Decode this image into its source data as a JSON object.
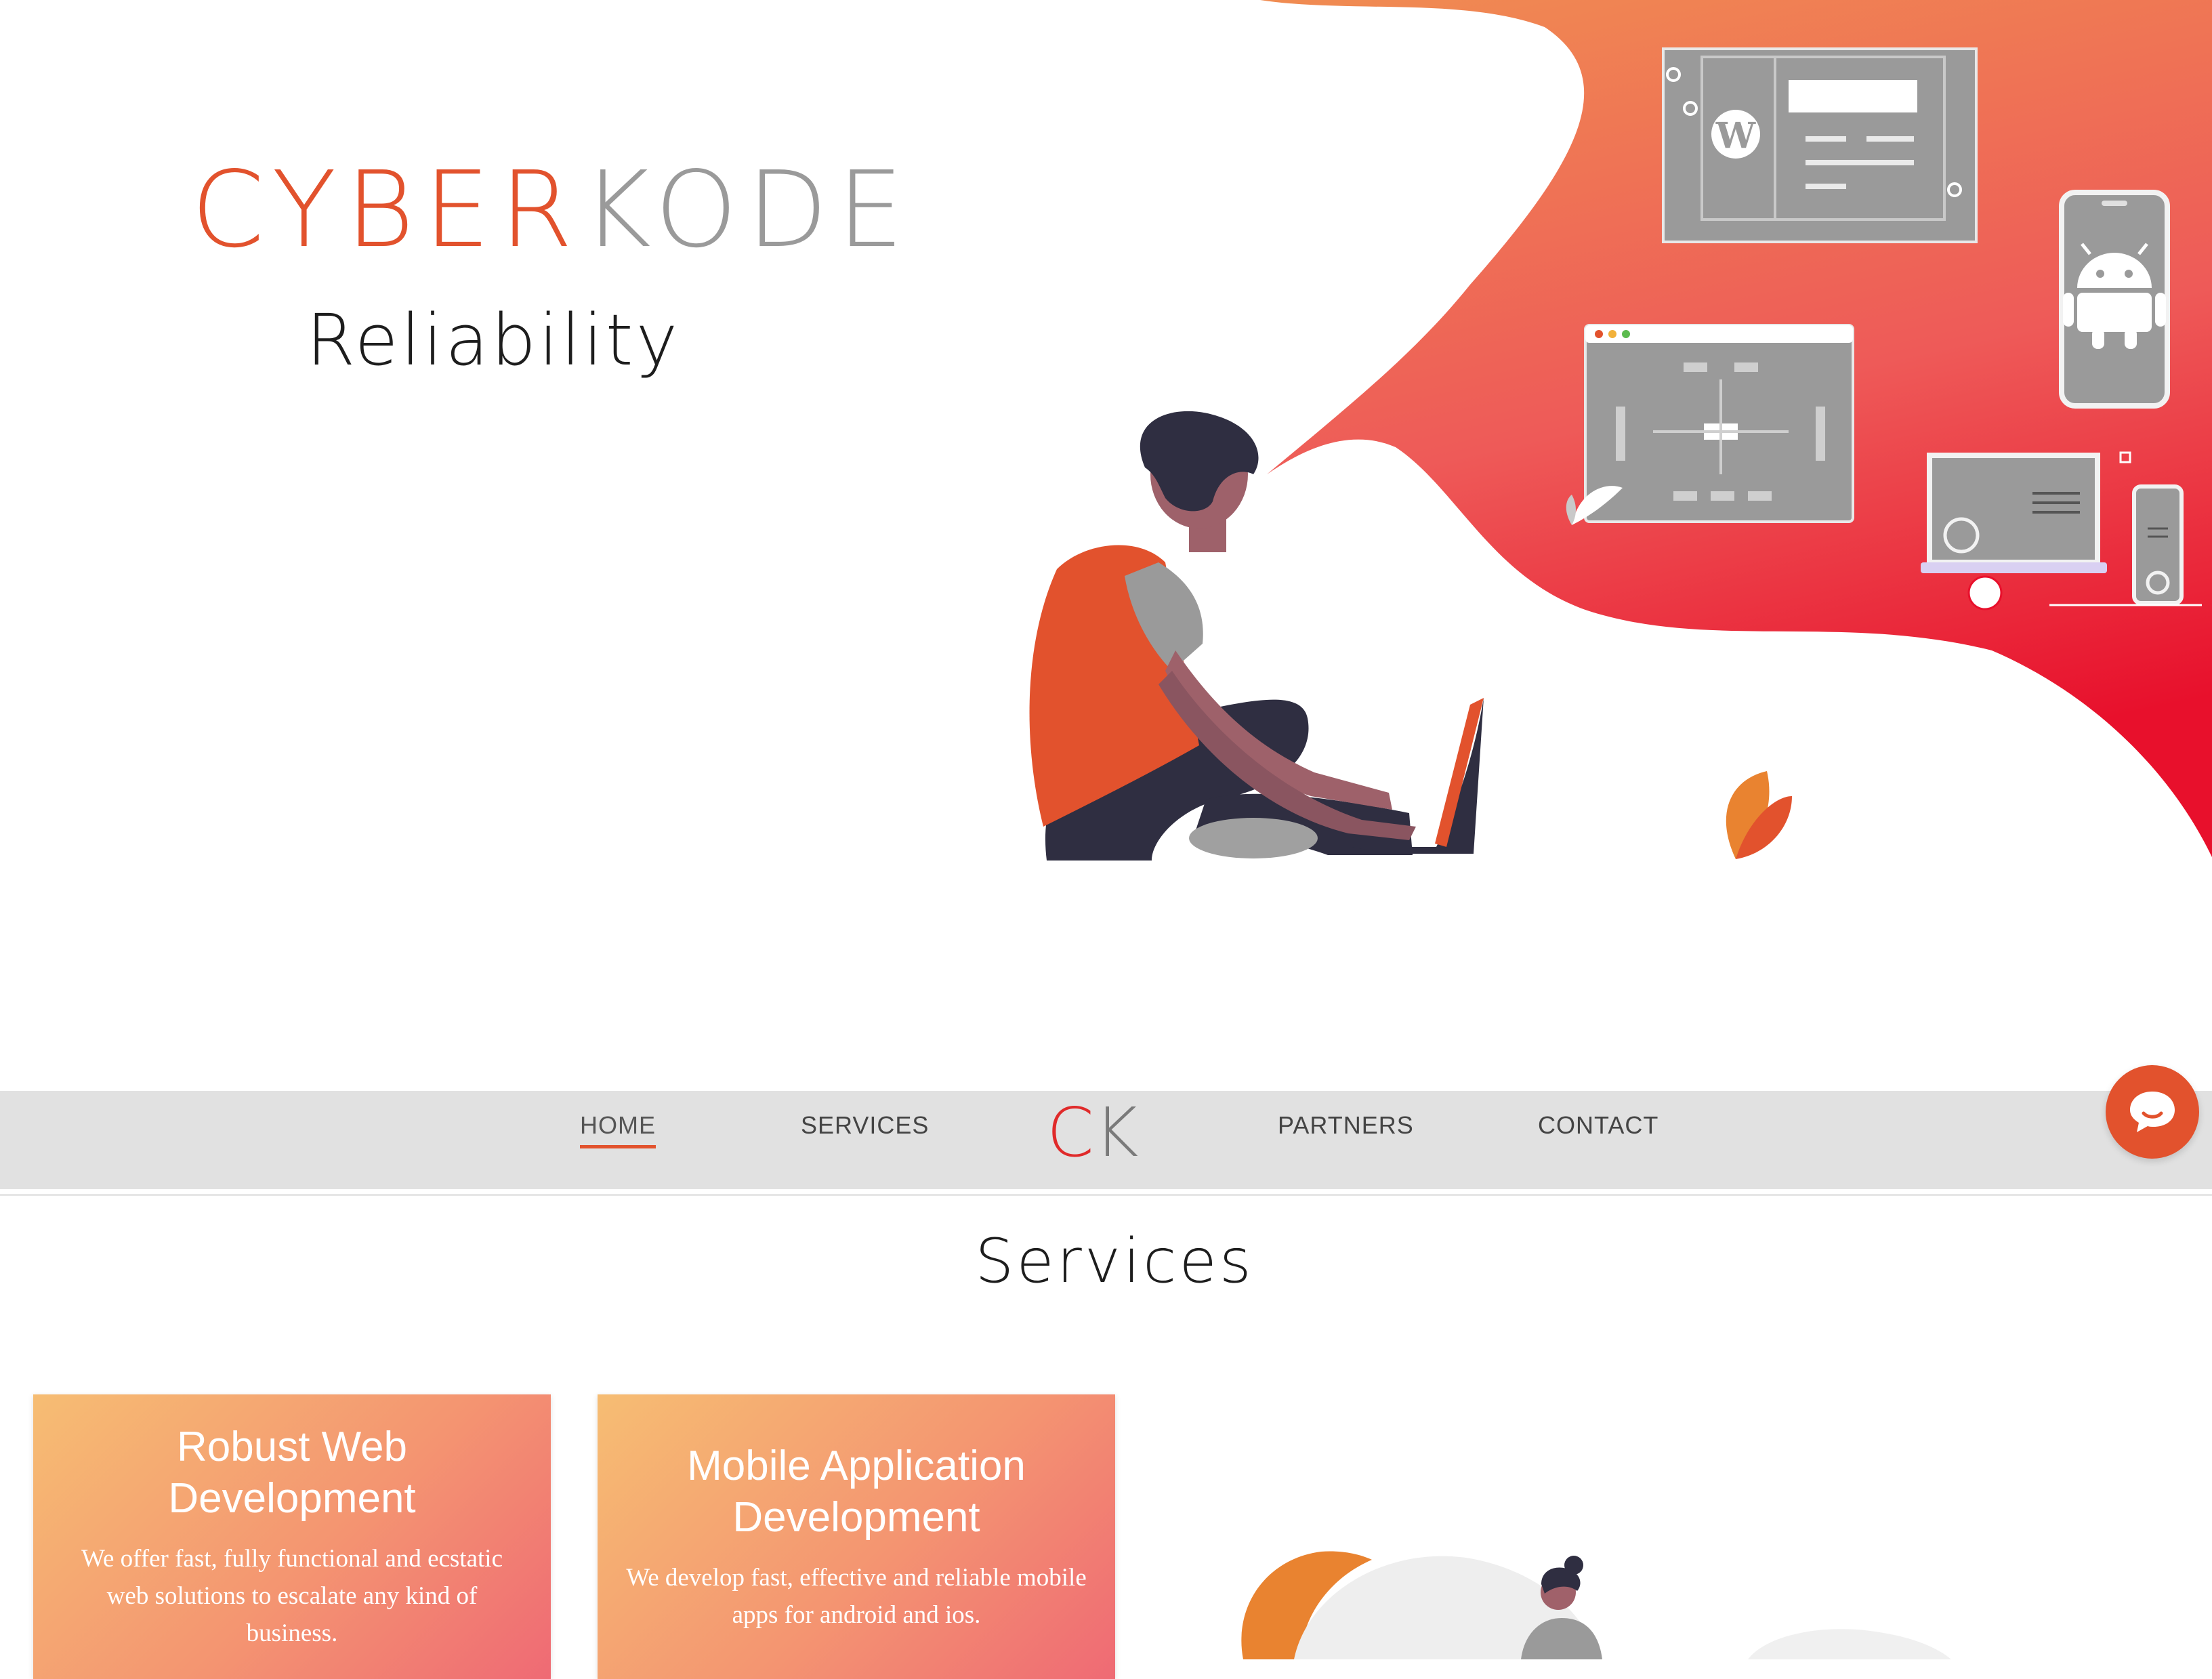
{
  "hero": {
    "brand_part1": "CYBER",
    "brand_part2": "KODE",
    "tagline": "Reliability"
  },
  "nav": {
    "items": [
      {
        "label": "HOME",
        "active": true
      },
      {
        "label": "SERVICES",
        "active": false
      },
      {
        "label": "PARTNERS",
        "active": false
      },
      {
        "label": "CONTACT",
        "active": false
      }
    ],
    "logo_c": "C",
    "logo_k": "K"
  },
  "chat": {
    "icon": "chat-bubble-icon"
  },
  "services": {
    "title": "Services",
    "cards": [
      {
        "title": "Robust Web Development",
        "text": "We offer fast, fully functional and ecstatic web solutions to escalate any kind of business."
      },
      {
        "title": "Mobile Application Development",
        "text": "We develop fast, effective and reliable mobile apps for android and ios."
      }
    ]
  },
  "colors": {
    "accent": "#e2522d",
    "gradient_top": "#f08c52",
    "gradient_bottom": "#e8102c",
    "card_gradient_start": "#f6bd73",
    "card_gradient_end": "#ef6a74",
    "navbar_bg": "#e1e1e1"
  },
  "icons": [
    "wordpress-icon",
    "android-icon",
    "chat-bubble-icon"
  ]
}
